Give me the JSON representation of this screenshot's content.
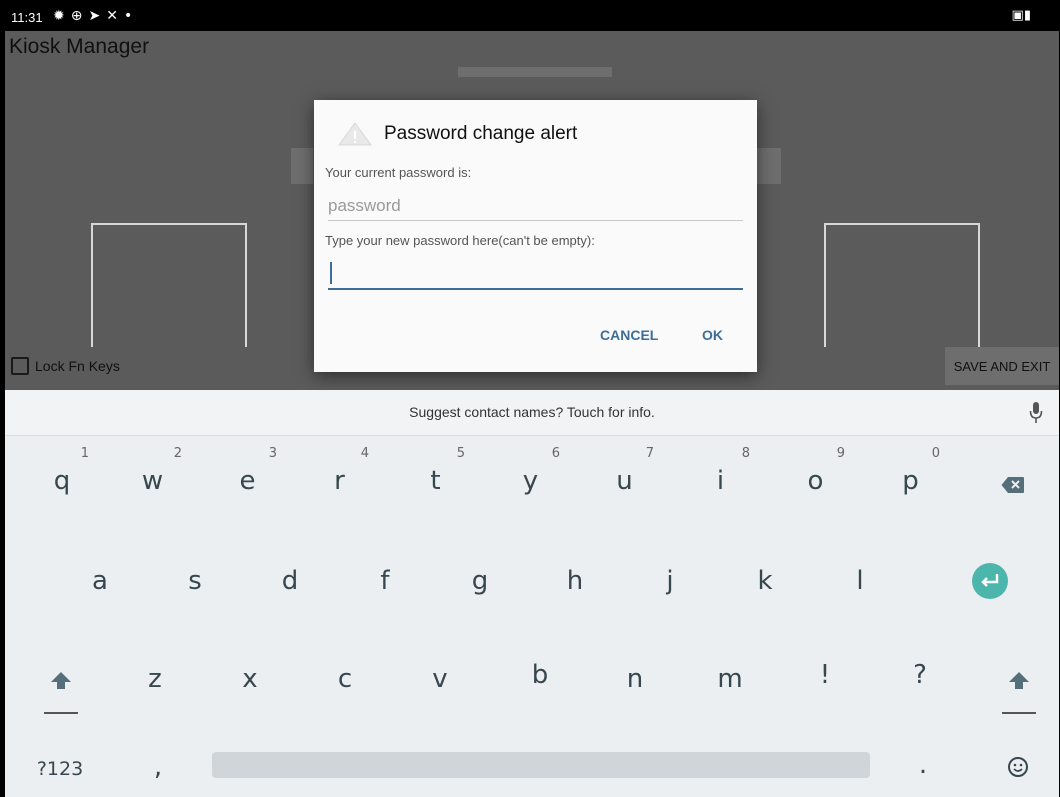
{
  "status_bar": {
    "time": "11:31",
    "icons": [
      "gear-icon",
      "vpn-icon",
      "location-icon",
      "tools-icon",
      "dot-icon"
    ],
    "right_icons": [
      "sim-icon",
      "battery-icon"
    ]
  },
  "app": {
    "title": "Kiosk Manager",
    "lock_fn_label": "Lock Fn Keys",
    "lock_fn_checked": false,
    "save_exit_label": "SAVE AND EXIT"
  },
  "dialog": {
    "title": "Password change alert",
    "current_label": "Your current password is:",
    "current_value": "password",
    "new_label": "Type your new password here(can't be empty):",
    "new_value": "",
    "cancel_label": "CANCEL",
    "ok_label": "OK",
    "accent": "#3d6e99"
  },
  "keyboard": {
    "suggestion": "Suggest contact names? Touch for info.",
    "row1": [
      {
        "ch": "q",
        "num": "1"
      },
      {
        "ch": "w",
        "num": "2"
      },
      {
        "ch": "e",
        "num": "3"
      },
      {
        "ch": "r",
        "num": "4"
      },
      {
        "ch": "t",
        "num": "5"
      },
      {
        "ch": "y",
        "num": "6"
      },
      {
        "ch": "u",
        "num": "7"
      },
      {
        "ch": "i",
        "num": "8"
      },
      {
        "ch": "o",
        "num": "9"
      },
      {
        "ch": "p",
        "num": "0"
      }
    ],
    "row2": [
      "a",
      "s",
      "d",
      "f",
      "g",
      "h",
      "j",
      "k",
      "l"
    ],
    "row3": [
      "z",
      "x",
      "c",
      "v",
      "b",
      "n",
      "m",
      "!",
      "?"
    ],
    "symbols_label": "?123",
    "comma": ",",
    "period": ".",
    "enter_color": "#4db6ac"
  }
}
